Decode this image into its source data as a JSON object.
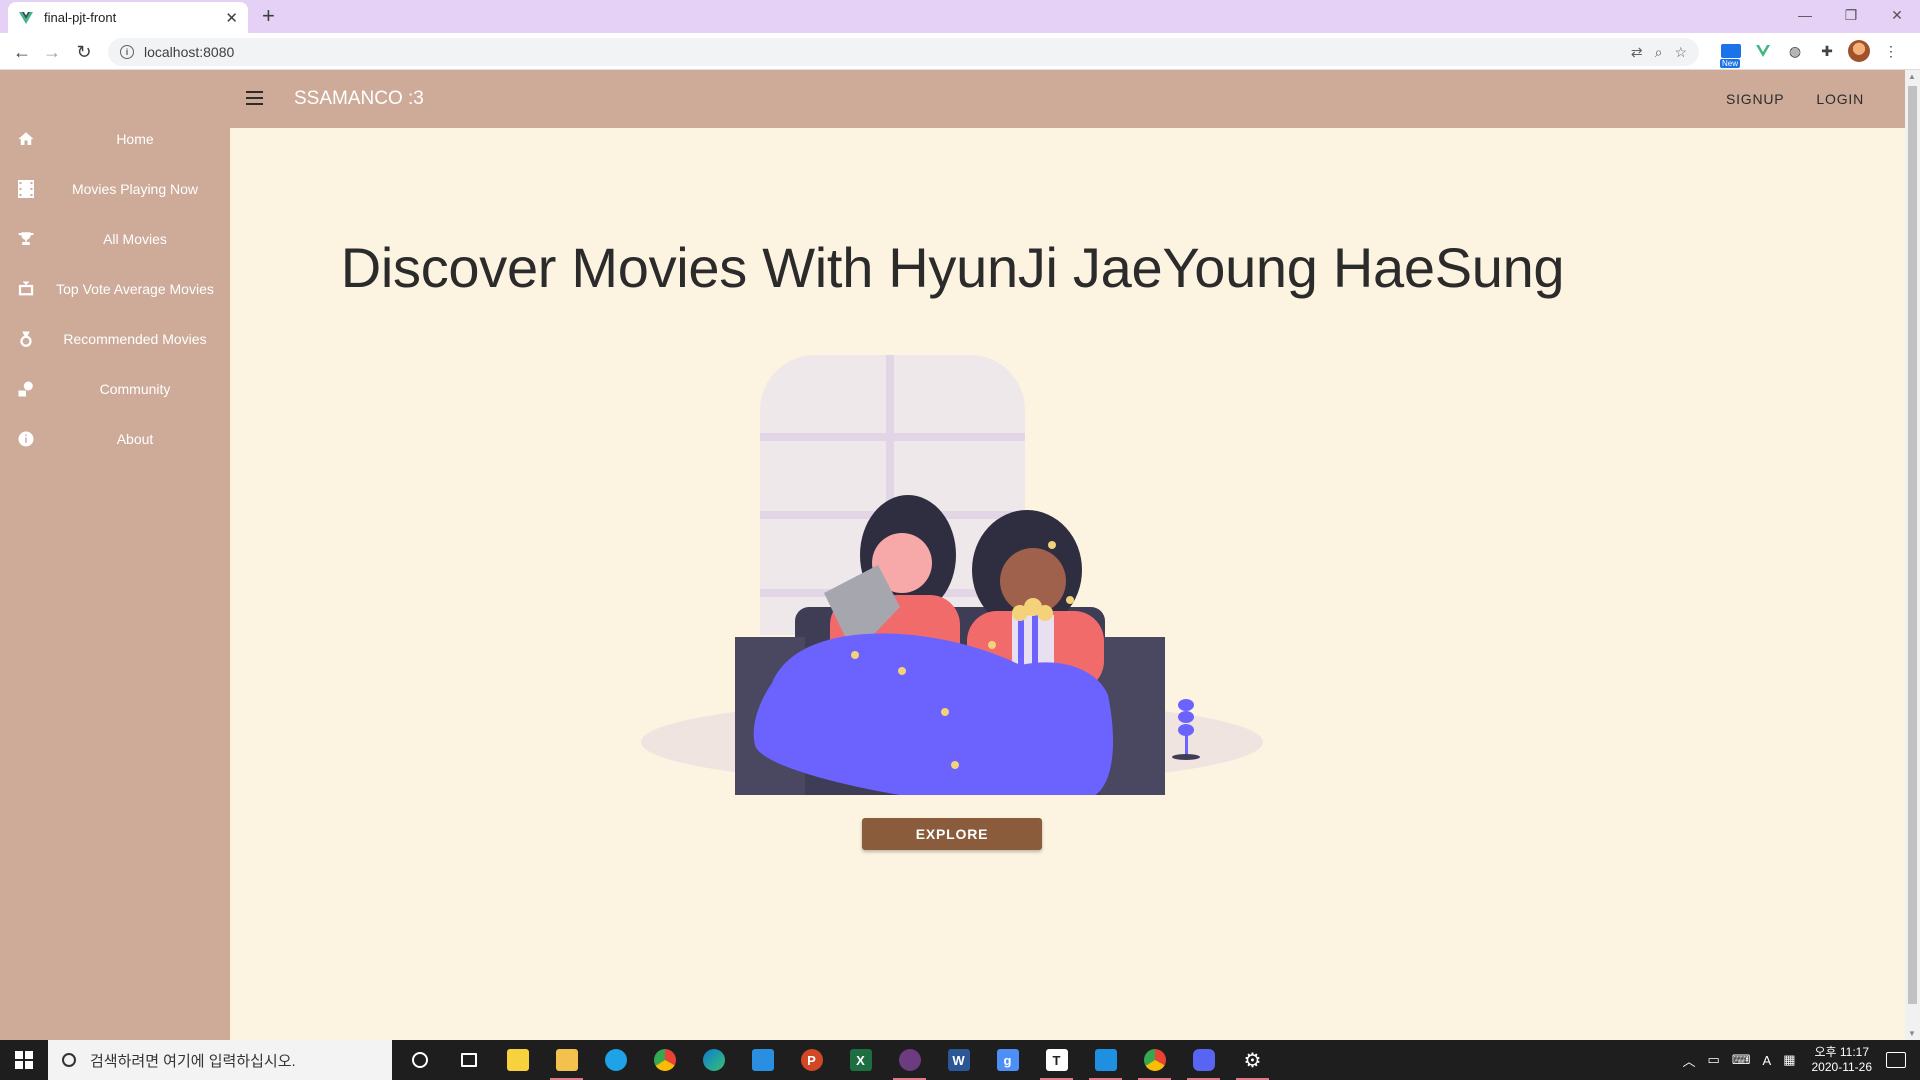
{
  "browser": {
    "tab_title": "final-pjt-front",
    "new_tab": "+",
    "url": "localhost:8080",
    "extension_badge": "New"
  },
  "app": {
    "brand": "SSAMANCO :3",
    "actions": {
      "signup": "SIGNUP",
      "login": "LOGIN"
    },
    "sidebar": [
      {
        "label": "Home",
        "icon": "home-icon"
      },
      {
        "label": "Movies Playing Now",
        "icon": "film-icon"
      },
      {
        "label": "All Movies",
        "icon": "trophy-icon"
      },
      {
        "label": "Top Vote Average Movies",
        "icon": "tv-icon"
      },
      {
        "label": "Recommended Movies",
        "icon": "medal-icon"
      },
      {
        "label": "Community",
        "icon": "chat-icon"
      },
      {
        "label": "About",
        "icon": "info-icon"
      }
    ],
    "hero_title": "Discover Movies With HyunJi JaeYoung HaeSung",
    "explore_label": "EXPLORE"
  },
  "taskbar": {
    "search_placeholder": "검색하려면 여기에 입력하십시오.",
    "time": "오후 11:17",
    "date": "2020-11-26",
    "ime": "A",
    "apps": [
      "cortana",
      "task-view",
      "sticky-notes",
      "file-explorer",
      "kingfisher",
      "chrome",
      "edge",
      "store",
      "powerpoint",
      "excel",
      "slack",
      "word",
      "g-app",
      "typora",
      "vscode",
      "chrome-alt",
      "discord",
      "settings"
    ]
  },
  "colors": {
    "sidebar": "#cdab98",
    "background": "#fdf3e1",
    "accent": "#8a5c3b",
    "illustration_blanket": "#6c63ff"
  }
}
